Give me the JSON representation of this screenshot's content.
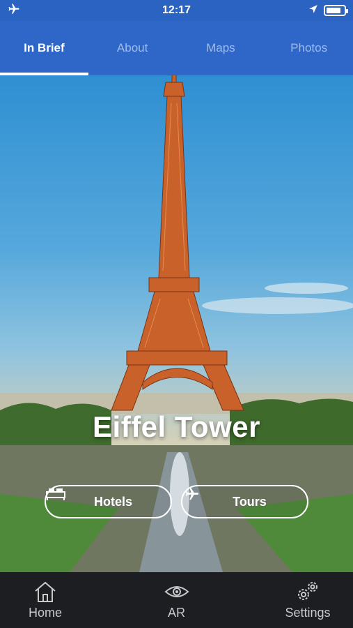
{
  "status_bar": {
    "time": "12:17",
    "left_icon": "airplane-mode-icon",
    "right_icons": [
      "location-arrow-icon",
      "battery-icon"
    ]
  },
  "tabs": [
    {
      "label": "In Brief",
      "active": true
    },
    {
      "label": "About",
      "active": false
    },
    {
      "label": "Maps",
      "active": false
    },
    {
      "label": "Photos",
      "active": false
    }
  ],
  "hero": {
    "title": "Eiffel Tower"
  },
  "actions": {
    "hotels": {
      "label": "Hotels",
      "icon": "bed-icon"
    },
    "tours": {
      "label": "Tours",
      "icon": "airplane-icon"
    }
  },
  "bottom_nav": [
    {
      "label": "Home",
      "icon": "home-icon"
    },
    {
      "label": "AR",
      "icon": "eye-icon"
    },
    {
      "label": "Settings",
      "icon": "gears-icon"
    }
  ],
  "colors": {
    "primary": "#2e67c7",
    "status_bar": "#2b63c2",
    "nav_bg": "#1e2024"
  }
}
